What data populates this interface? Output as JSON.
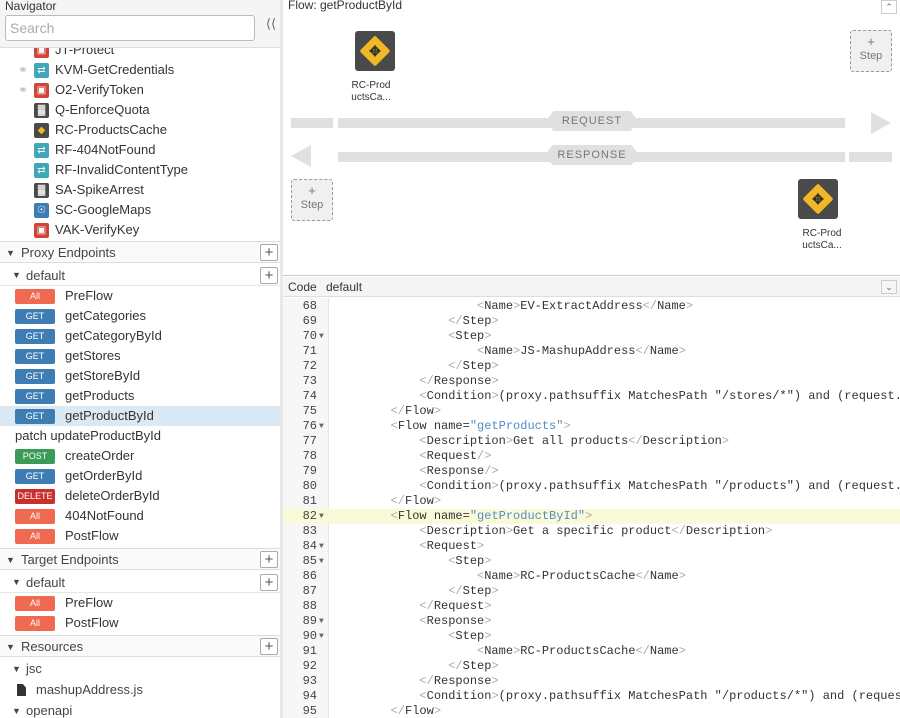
{
  "navigator": {
    "title": "Navigator",
    "search_placeholder": "Search",
    "collapse_icon": "double-chevron-left",
    "policies": [
      {
        "label": "JT-Protect",
        "color": "#d0453a",
        "linked": false
      },
      {
        "label": "KVM-GetCredentials",
        "color": "#3fa8b8",
        "linked": true
      },
      {
        "label": "O2-VerifyToken",
        "color": "#d0453a",
        "linked": true
      },
      {
        "label": "Q-EnforceQuota",
        "color": "#4a4a4a",
        "linked": false
      },
      {
        "label": "RC-ProductsCache",
        "color": "#4a4a4a",
        "linked": false
      },
      {
        "label": "RF-404NotFound",
        "color": "#3fa8b8",
        "linked": false
      },
      {
        "label": "RF-InvalidContentType",
        "color": "#3fa8b8",
        "linked": false
      },
      {
        "label": "SA-SpikeArrest",
        "color": "#4a4a4a",
        "linked": false
      },
      {
        "label": "SC-GoogleMaps",
        "color": "#3d7db3",
        "linked": false
      },
      {
        "label": "VAK-VerifyKey",
        "color": "#d0453a",
        "linked": false
      }
    ],
    "proxy_endpoints": {
      "label": "Proxy Endpoints",
      "default": "default",
      "flows": [
        {
          "verb": "All",
          "label": "PreFlow"
        },
        {
          "verb": "GET",
          "label": "getCategories"
        },
        {
          "verb": "GET",
          "label": "getCategoryById"
        },
        {
          "verb": "GET",
          "label": "getStores"
        },
        {
          "verb": "GET",
          "label": "getStoreById"
        },
        {
          "verb": "GET",
          "label": "getProducts"
        },
        {
          "verb": "GET",
          "label": "getProductById",
          "selected": true
        },
        {
          "verb": "patch",
          "label": "updateProductById"
        },
        {
          "verb": "POST",
          "label": "createOrder"
        },
        {
          "verb": "GET",
          "label": "getOrderById"
        },
        {
          "verb": "DELETE",
          "label": "deleteOrderById"
        },
        {
          "verb": "All",
          "label": "404NotFound"
        },
        {
          "verb": "All",
          "label": "PostFlow"
        }
      ]
    },
    "target_endpoints": {
      "label": "Target Endpoints",
      "default": "default",
      "flows": [
        {
          "verb": "All",
          "label": "PreFlow"
        },
        {
          "verb": "All",
          "label": "PostFlow"
        }
      ]
    },
    "resources": {
      "label": "Resources",
      "folders": [
        {
          "label": "jsc",
          "files": [
            "mashupAddress.js"
          ]
        },
        {
          "label": "openapi",
          "files": []
        }
      ]
    }
  },
  "flow_panel": {
    "title": "Flow: getProductById",
    "request_label": "REQUEST",
    "response_label": "RESPONSE",
    "step_plus": "+",
    "step_label": "Step",
    "request_policy": "RC-ProductsCa...",
    "response_policy": "RC-ProductsCa...",
    "policy_icon": "cache-diamond-icon"
  },
  "code_panel": {
    "tab": "Code",
    "file": "default",
    "highlight_line": 82,
    "lines": [
      {
        "n": 68,
        "fold": false,
        "t": [
          [
            "                    ",
            "tx"
          ],
          [
            "<",
            "tg"
          ],
          [
            "Name",
            "tn"
          ],
          [
            ">",
            "tg"
          ],
          [
            "EV-ExtractAddress",
            "tx"
          ],
          [
            "</",
            "tg"
          ],
          [
            "Name",
            "tn"
          ],
          [
            ">",
            "tg"
          ]
        ]
      },
      {
        "n": 69,
        "fold": false,
        "t": [
          [
            "                ",
            "tx"
          ],
          [
            "</",
            "tg"
          ],
          [
            "Step",
            "tn"
          ],
          [
            ">",
            "tg"
          ]
        ]
      },
      {
        "n": 70,
        "fold": true,
        "t": [
          [
            "                ",
            "tx"
          ],
          [
            "<",
            "tg"
          ],
          [
            "Step",
            "tn"
          ],
          [
            ">",
            "tg"
          ]
        ]
      },
      {
        "n": 71,
        "fold": false,
        "t": [
          [
            "                    ",
            "tx"
          ],
          [
            "<",
            "tg"
          ],
          [
            "Name",
            "tn"
          ],
          [
            ">",
            "tg"
          ],
          [
            "JS-MashupAddress",
            "tx"
          ],
          [
            "</",
            "tg"
          ],
          [
            "Name",
            "tn"
          ],
          [
            ">",
            "tg"
          ]
        ]
      },
      {
        "n": 72,
        "fold": false,
        "t": [
          [
            "                ",
            "tx"
          ],
          [
            "</",
            "tg"
          ],
          [
            "Step",
            "tn"
          ],
          [
            ">",
            "tg"
          ]
        ]
      },
      {
        "n": 73,
        "fold": false,
        "t": [
          [
            "            ",
            "tx"
          ],
          [
            "</",
            "tg"
          ],
          [
            "Response",
            "tn"
          ],
          [
            ">",
            "tg"
          ]
        ]
      },
      {
        "n": 74,
        "fold": false,
        "t": [
          [
            "            ",
            "tx"
          ],
          [
            "<",
            "tg"
          ],
          [
            "Condition",
            "tn"
          ],
          [
            ">",
            "tg"
          ],
          [
            "(proxy.pathsuffix MatchesPath \"/stores/*\") and (request.verb = \"GET\")",
            "tx"
          ]
        ]
      },
      {
        "n": 75,
        "fold": false,
        "t": [
          [
            "        ",
            "tx"
          ],
          [
            "</",
            "tg"
          ],
          [
            "Flow",
            "tn"
          ],
          [
            ">",
            "tg"
          ]
        ]
      },
      {
        "n": 76,
        "fold": true,
        "t": [
          [
            "        ",
            "tx"
          ],
          [
            "<",
            "tg"
          ],
          [
            "Flow",
            "tn"
          ],
          [
            " name=",
            "at"
          ],
          [
            "\"getProducts\"",
            "av"
          ],
          [
            ">",
            "tg"
          ]
        ]
      },
      {
        "n": 77,
        "fold": false,
        "t": [
          [
            "            ",
            "tx"
          ],
          [
            "<",
            "tg"
          ],
          [
            "Description",
            "tn"
          ],
          [
            ">",
            "tg"
          ],
          [
            "Get all products",
            "tx"
          ],
          [
            "</",
            "tg"
          ],
          [
            "Description",
            "tn"
          ],
          [
            ">",
            "tg"
          ]
        ]
      },
      {
        "n": 78,
        "fold": false,
        "t": [
          [
            "            ",
            "tx"
          ],
          [
            "<",
            "tg"
          ],
          [
            "Request",
            "tn"
          ],
          [
            "/>",
            "tg"
          ]
        ]
      },
      {
        "n": 79,
        "fold": false,
        "t": [
          [
            "            ",
            "tx"
          ],
          [
            "<",
            "tg"
          ],
          [
            "Response",
            "tn"
          ],
          [
            "/>",
            "tg"
          ]
        ]
      },
      {
        "n": 80,
        "fold": false,
        "t": [
          [
            "            ",
            "tx"
          ],
          [
            "<",
            "tg"
          ],
          [
            "Condition",
            "tn"
          ],
          [
            ">",
            "tg"
          ],
          [
            "(proxy.pathsuffix MatchesPath \"/products\") and (request.verb = \"GET\")",
            "tx"
          ]
        ]
      },
      {
        "n": 81,
        "fold": false,
        "t": [
          [
            "        ",
            "tx"
          ],
          [
            "</",
            "tg"
          ],
          [
            "Flow",
            "tn"
          ],
          [
            ">",
            "tg"
          ]
        ]
      },
      {
        "n": 82,
        "fold": true,
        "t": [
          [
            "        ",
            "tx"
          ],
          [
            "<",
            "tg"
          ],
          [
            "Flow",
            "tn"
          ],
          [
            " name=",
            "at"
          ],
          [
            "\"getProductById\"",
            "av"
          ],
          [
            ">",
            "tg"
          ]
        ]
      },
      {
        "n": 83,
        "fold": false,
        "t": [
          [
            "            ",
            "tx"
          ],
          [
            "<",
            "tg"
          ],
          [
            "Description",
            "tn"
          ],
          [
            ">",
            "tg"
          ],
          [
            "Get a specific product",
            "tx"
          ],
          [
            "</",
            "tg"
          ],
          [
            "Description",
            "tn"
          ],
          [
            ">",
            "tg"
          ]
        ]
      },
      {
        "n": 84,
        "fold": true,
        "t": [
          [
            "            ",
            "tx"
          ],
          [
            "<",
            "tg"
          ],
          [
            "Request",
            "tn"
          ],
          [
            ">",
            "tg"
          ]
        ]
      },
      {
        "n": 85,
        "fold": true,
        "t": [
          [
            "                ",
            "tx"
          ],
          [
            "<",
            "tg"
          ],
          [
            "Step",
            "tn"
          ],
          [
            ">",
            "tg"
          ]
        ]
      },
      {
        "n": 86,
        "fold": false,
        "t": [
          [
            "                    ",
            "tx"
          ],
          [
            "<",
            "tg"
          ],
          [
            "Name",
            "tn"
          ],
          [
            ">",
            "tg"
          ],
          [
            "RC-ProductsCache",
            "tx"
          ],
          [
            "</",
            "tg"
          ],
          [
            "Name",
            "tn"
          ],
          [
            ">",
            "tg"
          ]
        ]
      },
      {
        "n": 87,
        "fold": false,
        "t": [
          [
            "                ",
            "tx"
          ],
          [
            "</",
            "tg"
          ],
          [
            "Step",
            "tn"
          ],
          [
            ">",
            "tg"
          ]
        ]
      },
      {
        "n": 88,
        "fold": false,
        "t": [
          [
            "            ",
            "tx"
          ],
          [
            "</",
            "tg"
          ],
          [
            "Request",
            "tn"
          ],
          [
            ">",
            "tg"
          ]
        ]
      },
      {
        "n": 89,
        "fold": true,
        "t": [
          [
            "            ",
            "tx"
          ],
          [
            "<",
            "tg"
          ],
          [
            "Response",
            "tn"
          ],
          [
            ">",
            "tg"
          ]
        ]
      },
      {
        "n": 90,
        "fold": true,
        "t": [
          [
            "                ",
            "tx"
          ],
          [
            "<",
            "tg"
          ],
          [
            "Step",
            "tn"
          ],
          [
            ">",
            "tg"
          ]
        ]
      },
      {
        "n": 91,
        "fold": false,
        "t": [
          [
            "                    ",
            "tx"
          ],
          [
            "<",
            "tg"
          ],
          [
            "Name",
            "tn"
          ],
          [
            ">",
            "tg"
          ],
          [
            "RC-ProductsCache",
            "tx"
          ],
          [
            "</",
            "tg"
          ],
          [
            "Name",
            "tn"
          ],
          [
            ">",
            "tg"
          ]
        ]
      },
      {
        "n": 92,
        "fold": false,
        "t": [
          [
            "                ",
            "tx"
          ],
          [
            "</",
            "tg"
          ],
          [
            "Step",
            "tn"
          ],
          [
            ">",
            "tg"
          ]
        ]
      },
      {
        "n": 93,
        "fold": false,
        "t": [
          [
            "            ",
            "tx"
          ],
          [
            "</",
            "tg"
          ],
          [
            "Response",
            "tn"
          ],
          [
            ">",
            "tg"
          ]
        ]
      },
      {
        "n": 94,
        "fold": false,
        "t": [
          [
            "            ",
            "tx"
          ],
          [
            "<",
            "tg"
          ],
          [
            "Condition",
            "tn"
          ],
          [
            ">",
            "tg"
          ],
          [
            "(proxy.pathsuffix MatchesPath \"/products/*\") and (request.verb = \"GET\")",
            "tx"
          ]
        ]
      },
      {
        "n": 95,
        "fold": false,
        "t": [
          [
            "        ",
            "tx"
          ],
          [
            "</",
            "tg"
          ],
          [
            "Flow",
            "tn"
          ],
          [
            ">",
            "tg"
          ]
        ]
      }
    ]
  }
}
